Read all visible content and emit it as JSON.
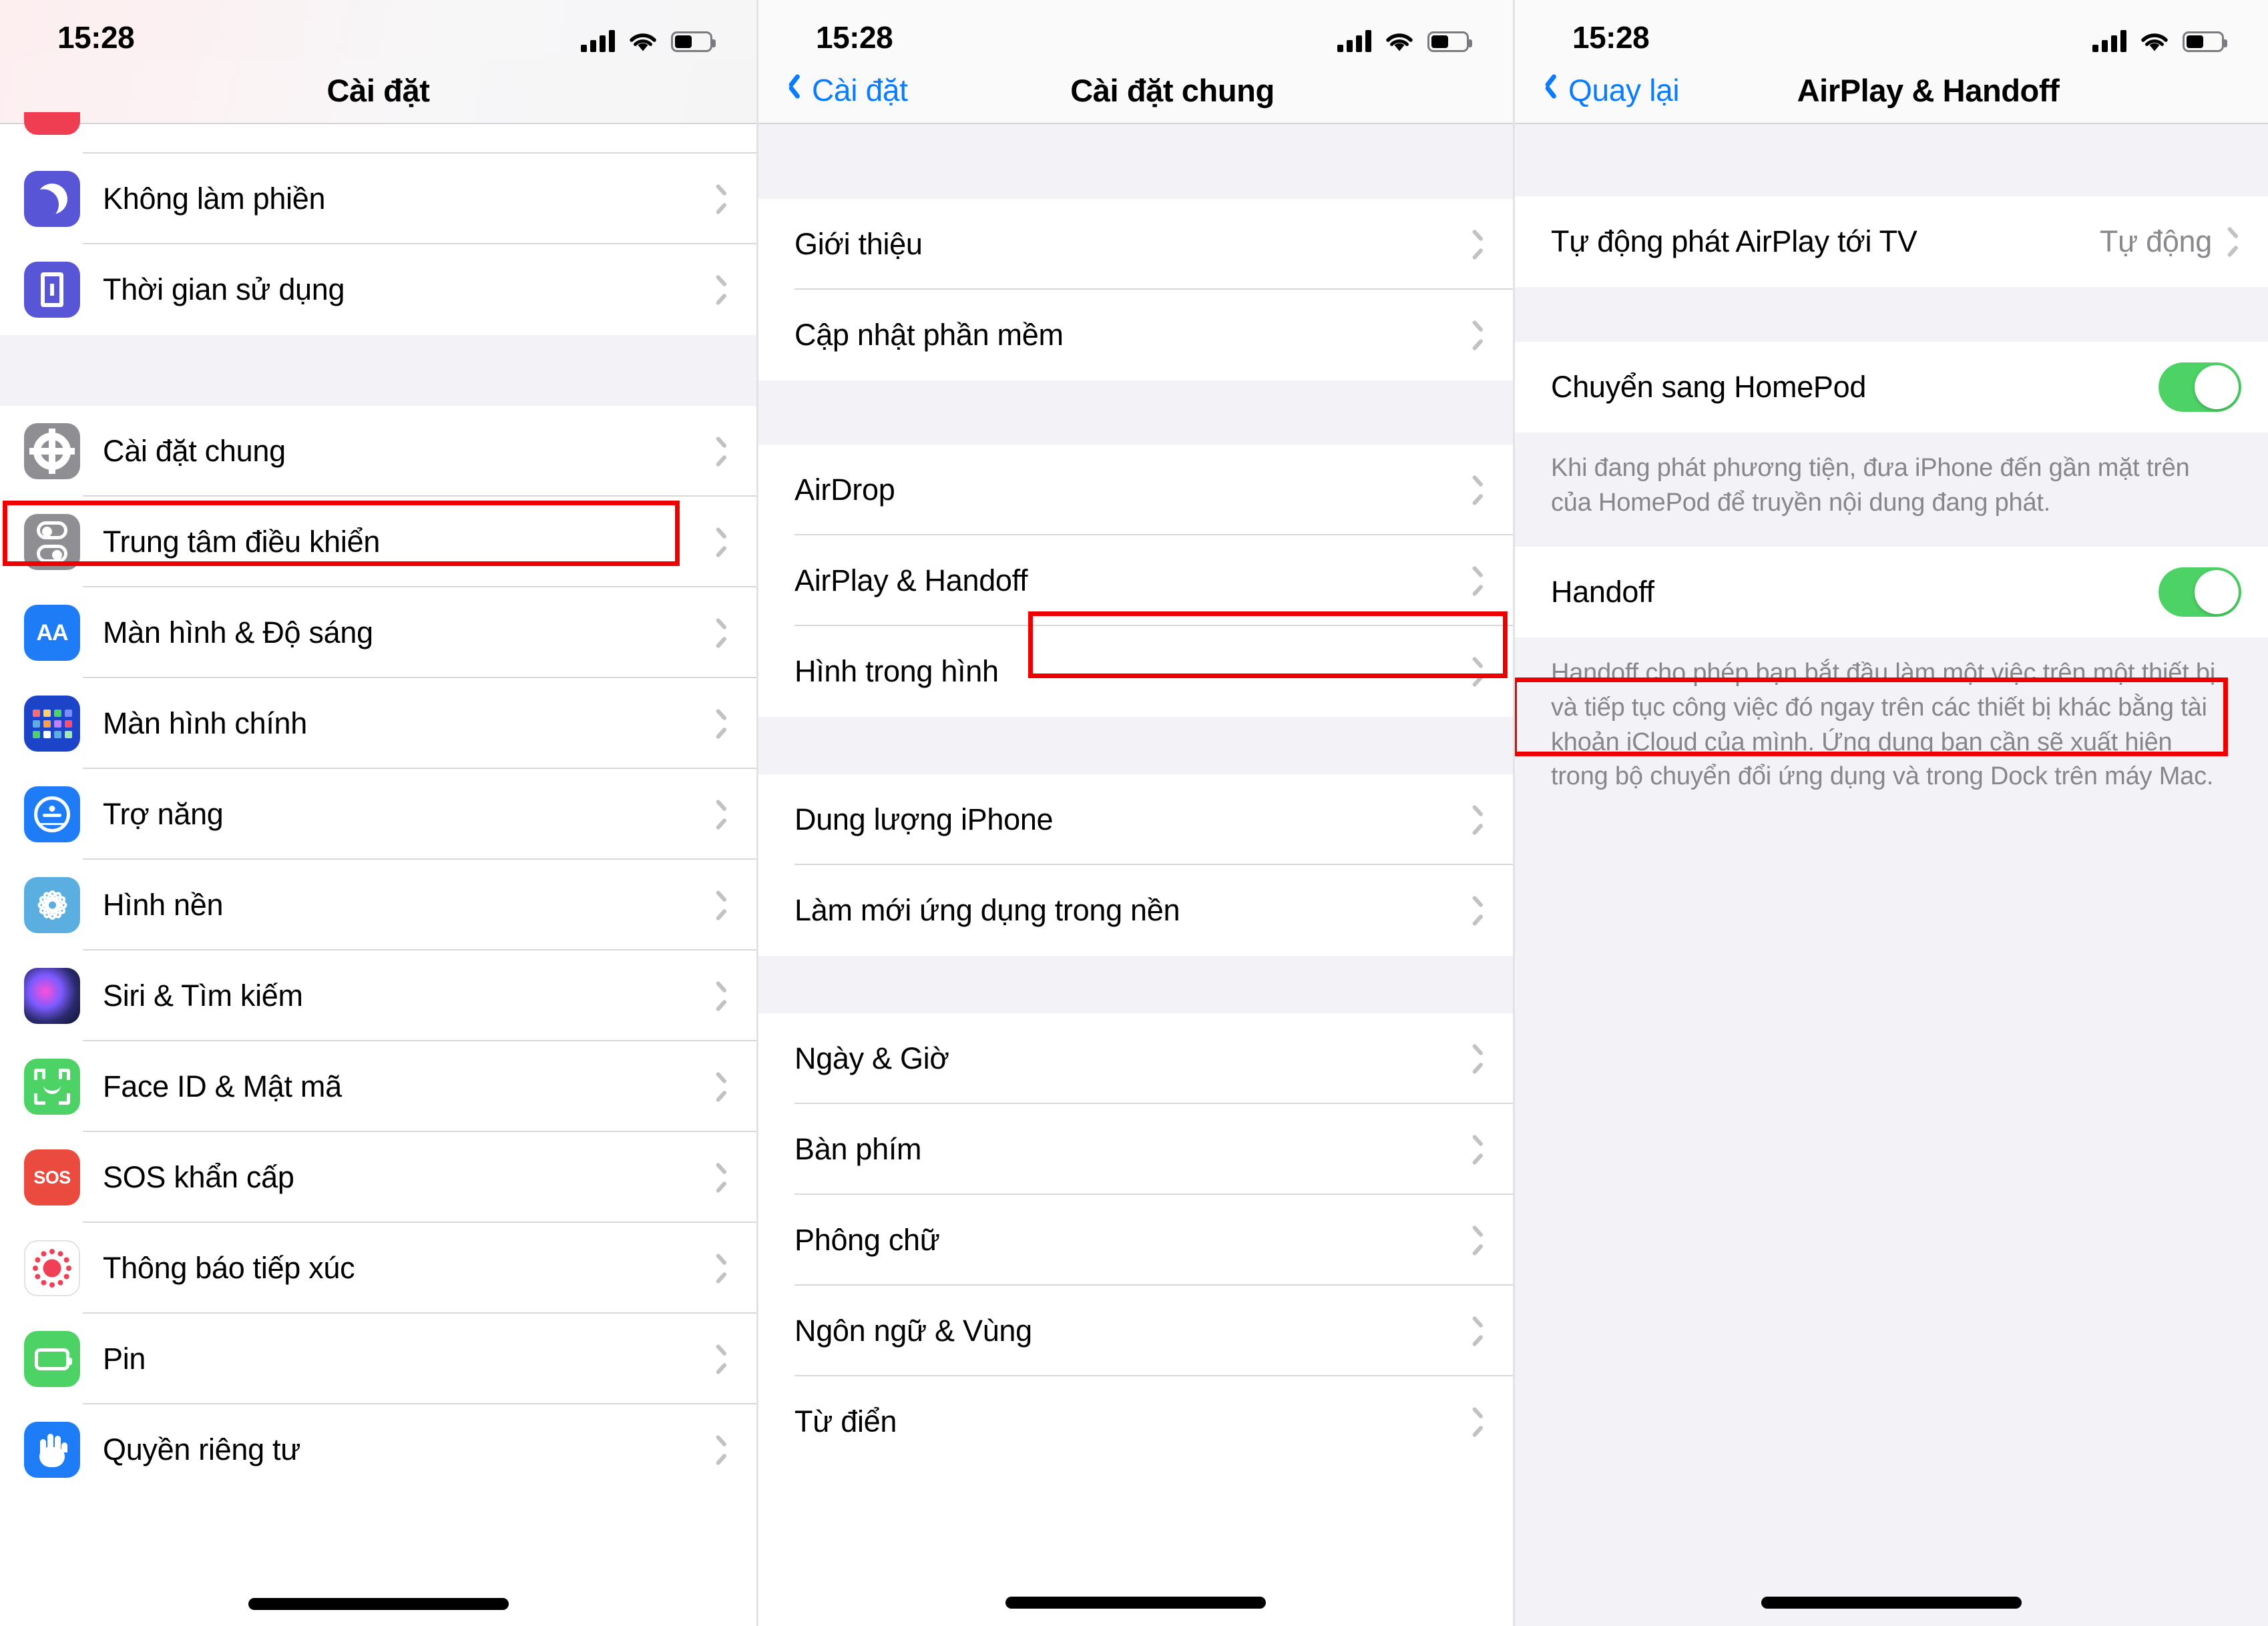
{
  "status_bar": {
    "time": "15:28",
    "signal_icon": "cellular-bars",
    "wifi_icon": "wifi",
    "battery_icon": "battery-half"
  },
  "panel1": {
    "nav": {
      "title": "Cài đặt"
    },
    "items_top": [
      {
        "label": "Không làm phiền",
        "icon": "do-not-disturb-icon"
      },
      {
        "label": "Thời gian sử dụng",
        "icon": "screen-time-icon"
      }
    ],
    "items_main": [
      {
        "label": "Cài đặt chung",
        "icon": "gear-icon",
        "highlight": true
      },
      {
        "label": "Trung tâm điều khiển",
        "icon": "control-center-icon"
      },
      {
        "label": "Màn hình & Độ sáng",
        "icon": "display-brightness-icon"
      },
      {
        "label": "Màn hình chính",
        "icon": "home-screen-icon"
      },
      {
        "label": "Trợ năng",
        "icon": "accessibility-icon"
      },
      {
        "label": "Hình nền",
        "icon": "wallpaper-icon"
      },
      {
        "label": "Siri & Tìm kiếm",
        "icon": "siri-icon"
      },
      {
        "label": "Face ID & Mật mã",
        "icon": "face-id-icon"
      },
      {
        "label": "SOS khẩn cấp",
        "icon": "sos-icon"
      },
      {
        "label": "Thông báo tiếp xúc",
        "icon": "exposure-notification-icon"
      },
      {
        "label": "Pin",
        "icon": "battery-icon"
      },
      {
        "label": "Quyền riêng tư",
        "icon": "privacy-hand-icon"
      }
    ]
  },
  "panel2": {
    "nav": {
      "back_label": "Cài đặt",
      "title": "Cài đặt chung"
    },
    "group1": [
      {
        "label": "Giới thiệu"
      },
      {
        "label": "Cập nhật phần mềm"
      }
    ],
    "group2": [
      {
        "label": "AirDrop"
      },
      {
        "label": "AirPlay & Handoff",
        "highlight": true
      },
      {
        "label": "Hình trong hình"
      }
    ],
    "group3": [
      {
        "label": "Dung lượng iPhone"
      },
      {
        "label": "Làm mới ứng dụng trong nền"
      }
    ],
    "group4": [
      {
        "label": "Ngày & Giờ"
      },
      {
        "label": "Bàn phím"
      },
      {
        "label": "Phông chữ"
      },
      {
        "label": "Ngôn ngữ & Vùng"
      },
      {
        "label": "Từ điển"
      }
    ]
  },
  "panel3": {
    "nav": {
      "back_label": "Quay lại",
      "title": "AirPlay & Handoff"
    },
    "row_airplay_tv": {
      "label": "Tự động phát AirPlay tới TV",
      "value": "Tự động"
    },
    "row_homepod": {
      "label": "Chuyển sang HomePod",
      "toggle": "on"
    },
    "note_homepod": "Khi đang phát phương tiện, đưa iPhone đến gần mặt trên của HomePod để truyền nội dung đang phát.",
    "row_handoff": {
      "label": "Handoff",
      "toggle": "on",
      "highlight": true
    },
    "note_handoff": "Handoff cho phép bạn bắt đầu làm một việc trên một thiết bị và tiếp tục công việc đó ngay trên các thiết bị khác bằng tài khoản iCloud của mình. Ứng dụng bạn cần sẽ xuất hiện trong bộ chuyển đổi ứng dụng và trong Dock trên máy Mac."
  },
  "colors": {
    "accent_blue": "#0a7cff",
    "toggle_on_green": "#4cd265",
    "highlight_red": "#ee0000",
    "group_bg": "#f2f2f7",
    "value_gray": "#8a8a8e"
  }
}
